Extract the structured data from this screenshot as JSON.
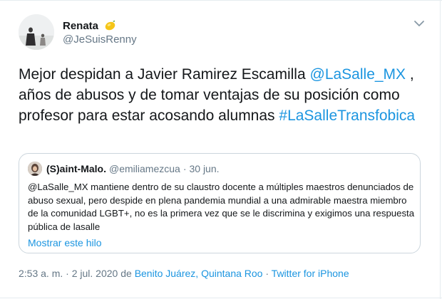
{
  "author": {
    "display_name": "Renata",
    "handle": "@JeSuisRenny",
    "emoji": "lemon-icon"
  },
  "tweet": {
    "text_before": "Mejor despidan a Javier Ramirez Escamilla ",
    "mention": "@LaSalle_MX",
    "text_after": " , años de abusos y de tomar ventajas de su posición como profesor para estar acosando alumnas ",
    "hashtag": "#LaSalleTransfobica"
  },
  "quoted": {
    "display_name": "(S)aint-Malo.",
    "handle": "@emiliamezcua",
    "separator": "·",
    "date": "30 jun.",
    "text": "@LaSalle_MX mantiene dentro de su claustro docente a múltiples maestros denunciados de abuso sexual, pero despide en plena pandemia mundial a una admirable maestra miembro de la comunidad LGBT+, no es la primera vez que se le discrimina y exigimos una respuesta pública de lasalle",
    "show_thread": "Mostrar este hilo"
  },
  "meta": {
    "time": "2:53 a. m.",
    "sep1": " · ",
    "date": "2 jul. 2020",
    "from": " de ",
    "location": "Benito Juárez, Quintana Roo",
    "sep2": " · ",
    "client": "Twitter for iPhone"
  },
  "colors": {
    "link": "#1b95e0",
    "secondary_text": "#657786",
    "primary_text": "#14171a",
    "border": "#ccd6dd"
  }
}
